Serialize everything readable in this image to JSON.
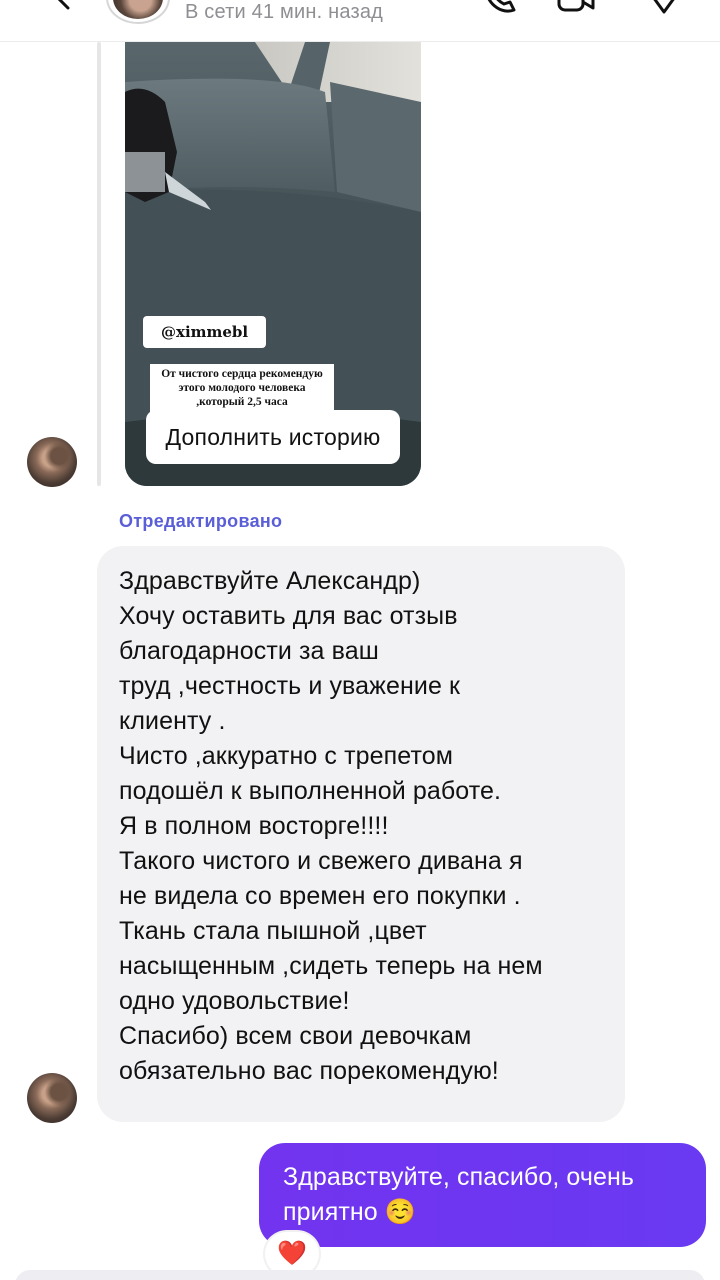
{
  "header": {
    "status": "В сети 41 мин. назад"
  },
  "story": {
    "tag": "@ximmebl",
    "caption": "От чистого сердца рекомендую этого молодого человека ,который 2,5 часа",
    "add_button": "Дополнить историю"
  },
  "messages": {
    "edited_label": "Отредактировано",
    "incoming_lines": [
      "Здравствуйте Александр)",
      "Хочу оставить для вас отзыв",
      "благодарности за ваш",
      "труд ,честность и уважение к",
      "клиенту .",
      "Чисто ,аккуратно с трепетом",
      "подошёл к выполненной работе.",
      "Я в полном восторге!!!!",
      "Такого чистого и свежего дивана я",
      "не видела со времен его покупки .",
      "Ткань стала пышной ,цвет",
      "насыщенным ,сидеть теперь на нем",
      "одно удовольствие!",
      "Спасибо) всем свои девочкам",
      "обязательно вас порекомендую!"
    ],
    "outgoing_lines": [
      "Здравствуйте, спасибо, очень",
      "приятно ☺️"
    ],
    "reaction": "❤️"
  },
  "colors": {
    "accent": "#6d36f0",
    "edited": "#5b5fd7",
    "bubble_in": "#f2f2f4",
    "status_text": "#8e8e93"
  },
  "icons": [
    "back-icon",
    "phone-icon",
    "video-icon",
    "heart-icon"
  ]
}
